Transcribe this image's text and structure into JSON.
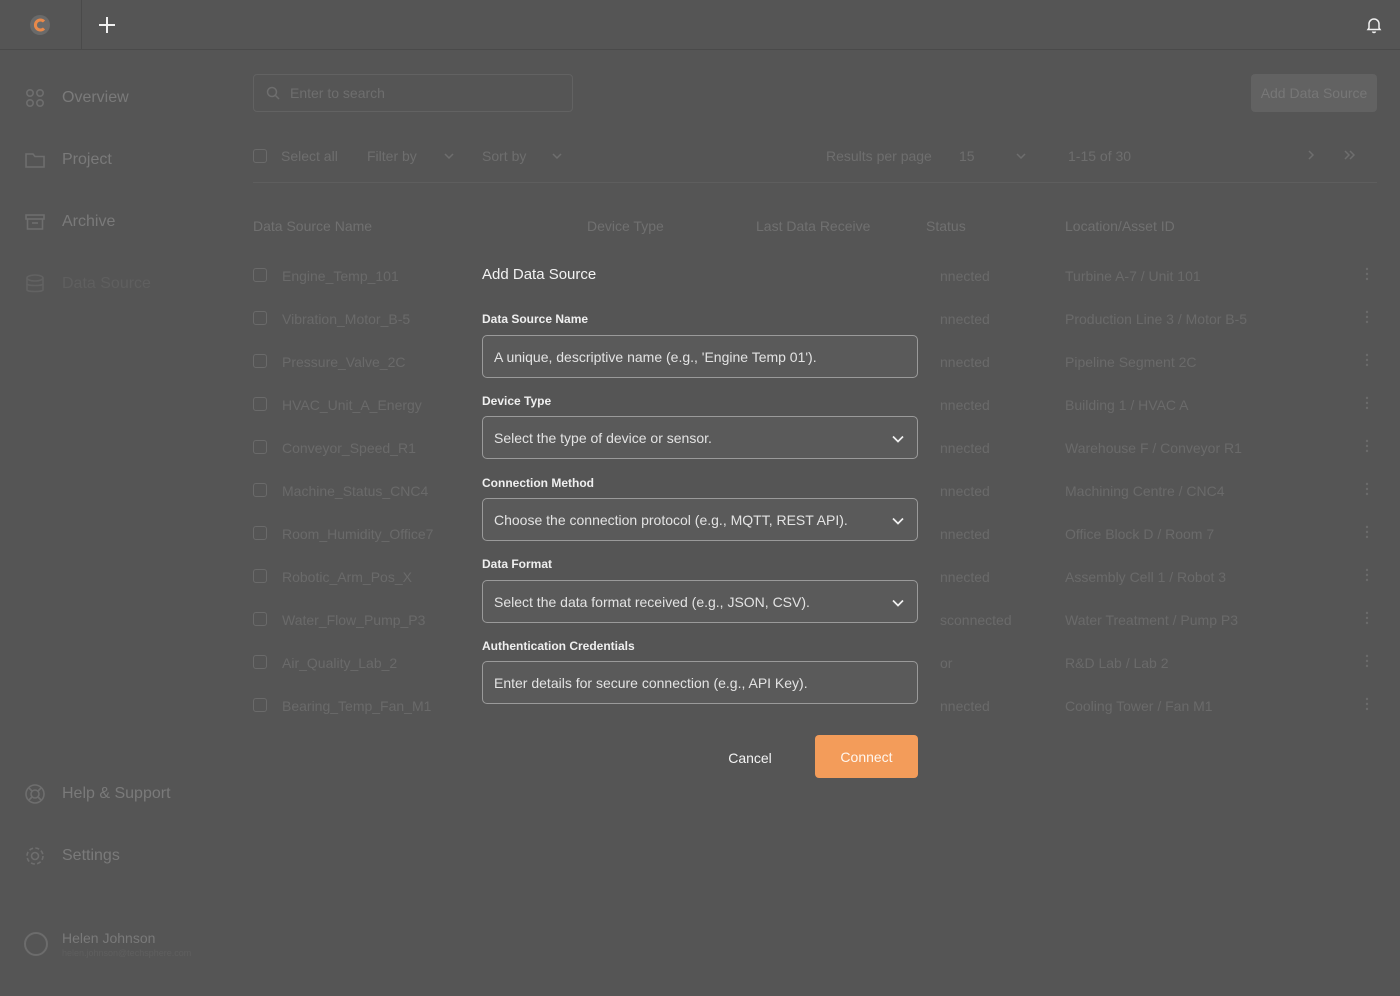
{
  "topbar": {
    "logo_icon": "app-logo-icon",
    "new_icon": "plus-icon",
    "notif_icon": "bell-icon"
  },
  "sidebar": {
    "items": [
      {
        "label": "Overview",
        "icon": "grid-icon"
      },
      {
        "label": "Project",
        "icon": "folder-icon"
      },
      {
        "label": "Archive",
        "icon": "archive-icon"
      },
      {
        "label": "Data Source",
        "icon": "database-icon"
      }
    ],
    "bottom": [
      {
        "label": "Help & Support",
        "icon": "lifebuoy-icon"
      },
      {
        "label": "Settings",
        "icon": "gear-icon"
      }
    ],
    "user": {
      "name": "Helen Johnson",
      "email": "helen.johnson@techsphere.com"
    }
  },
  "main": {
    "search_placeholder": "Enter to search",
    "add_button": "Add Data Source",
    "toolbar": {
      "select_all": "Select all",
      "filter_by": "Filter by",
      "sort_by": "Sort by",
      "results_per_page_label": "Results per page",
      "results_per_page_value": "15",
      "range": "1-15 of 30"
    },
    "columns": [
      "Data Source Name",
      "Device Type",
      "Last Data Receive",
      "Status",
      "Location/Asset ID"
    ],
    "rows": [
      {
        "name": "Engine_Temp_101",
        "status": "nnected",
        "location": "Turbine A-7 / Unit 101"
      },
      {
        "name": "Vibration_Motor_B-5",
        "status": "nnected",
        "location": "Production Line 3 / Motor B-5"
      },
      {
        "name": "Pressure_Valve_2C",
        "status": "nnected",
        "location": "Pipeline Segment 2C"
      },
      {
        "name": "HVAC_Unit_A_Energy",
        "status": "nnected",
        "location": "Building 1 / HVAC A"
      },
      {
        "name": "Conveyor_Speed_R1",
        "status": "nnected",
        "location": "Warehouse F / Conveyor R1"
      },
      {
        "name": "Machine_Status_CNC4",
        "status": "nnected",
        "location": "Machining Centre / CNC4"
      },
      {
        "name": "Room_Humidity_Office7",
        "status": "nnected",
        "location": "Office Block D / Room 7"
      },
      {
        "name": "Robotic_Arm_Pos_X",
        "status": "nnected",
        "location": "Assembly Cell 1 / Robot 3"
      },
      {
        "name": "Water_Flow_Pump_P3",
        "status": "sconnected",
        "location": "Water Treatment / Pump P3"
      },
      {
        "name": "Air_Quality_Lab_2",
        "status": "or",
        "location": "R&D Lab / Lab 2"
      },
      {
        "name": "Bearing_Temp_Fan_M1",
        "status": "nnected",
        "location": "Cooling Tower / Fan M1"
      }
    ]
  },
  "modal": {
    "title": "Add Data Source",
    "fields": [
      {
        "label": "Data Source Name",
        "placeholder": "A unique, descriptive name (e.g., 'Engine Temp 01')."
      },
      {
        "label": "Device Type",
        "placeholder": "Select the type of device or sensor."
      },
      {
        "label": "Connection Method",
        "placeholder": "Choose the connection protocol (e.g., MQTT, REST API)."
      },
      {
        "label": "Data Format",
        "placeholder": "Select the data format received (e.g., JSON, CSV)."
      },
      {
        "label": "Authentication Credentials",
        "placeholder": "Enter details for secure connection (e.g., API Key)."
      }
    ],
    "cancel": "Cancel",
    "connect": "Connect",
    "accent_color": "#f39c5a"
  }
}
